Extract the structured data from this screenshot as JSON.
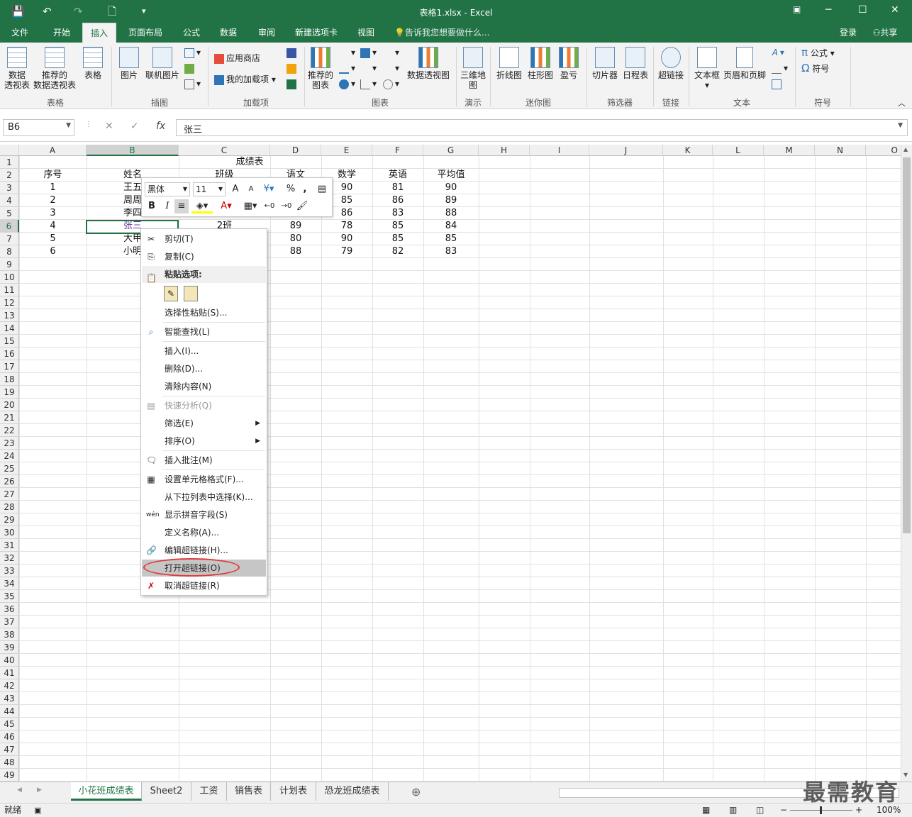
{
  "window": {
    "title": "表格1.xlsx - Excel",
    "restore_icon": "restore-icon",
    "min": "─",
    "max": "☐",
    "close": "✕"
  },
  "quick_access": {
    "save": "💾",
    "undo": "↶",
    "redo": "↷",
    "new": "🗋",
    "more": "▾"
  },
  "tabs": [
    "文件",
    "开始",
    "插入",
    "页面布局",
    "公式",
    "数据",
    "审阅",
    "新建选项卡",
    "视图"
  ],
  "active_tab": "插入",
  "tellme": "告诉我您想要做什么...",
  "login": "登录",
  "share": "共享",
  "ribbon": {
    "pivot": "数据\n透视表",
    "rec_pivot": "推荐的\n数据透视表",
    "table": "表格",
    "group_table": "表格",
    "picture": "图片",
    "online_picture": "联机图片",
    "group_illus": "插图",
    "store": "应用商店",
    "myaddins": "我的加载项",
    "group_addins": "加载项",
    "rec_charts": "推荐的\n图表",
    "pivotchart": "数据透视图",
    "group_charts": "图表",
    "map3d": "三维地\n图",
    "group_tour": "演示",
    "line": "折线图",
    "column": "柱形图",
    "winloss": "盈亏",
    "group_spark": "迷你图",
    "slicer": "切片器",
    "timeline": "日程表",
    "group_filter": "筛选器",
    "hyperlink": "超链接",
    "group_links": "链接",
    "textbox": "文本框",
    "headerfooter": "页眉和页脚",
    "group_text": "文本",
    "equation": "公式",
    "symbol": "符号",
    "group_symbols": "符号"
  },
  "formula_bar": {
    "name_box": "B6",
    "fx": "fx",
    "cancel": "✕",
    "enter": "✓",
    "value": "张三"
  },
  "columns": [
    "A",
    "B",
    "C",
    "D",
    "E",
    "F",
    "G",
    "H",
    "I",
    "J",
    "K",
    "L",
    "M",
    "N",
    "O"
  ],
  "sheet": {
    "title": "成绩表",
    "headers": [
      "序号",
      "姓名",
      "班级",
      "语文",
      "数学",
      "英语",
      "平均值"
    ],
    "rows": [
      [
        "1",
        "王五",
        "",
        "",
        "90",
        "81",
        "90"
      ],
      [
        "2",
        "周周",
        "",
        "",
        "85",
        "86",
        "89"
      ],
      [
        "3",
        "李四",
        "",
        "",
        "86",
        "83",
        "88"
      ],
      [
        "4",
        "张三",
        "2班",
        "89",
        "78",
        "85",
        "84"
      ],
      [
        "5",
        "大甲",
        "",
        "80",
        "90",
        "85",
        "85"
      ],
      [
        "6",
        "小明",
        "",
        "88",
        "79",
        "82",
        "83"
      ]
    ]
  },
  "mini_toolbar": {
    "font": "黑体",
    "size": "11",
    "grow": "A",
    "shrink": "A",
    "percent": "%",
    "comma": ",",
    "bold": "B",
    "italic": "I",
    "fontcolor": "A"
  },
  "context_menu": {
    "cut": "剪切(T)",
    "copy": "复制(C)",
    "paste_header": "粘贴选项:",
    "paste_special": "选择性粘贴(S)...",
    "smart_lookup": "智能查找(L)",
    "insert": "插入(I)...",
    "delete": "删除(D)...",
    "clear": "清除内容(N)",
    "quick_analysis": "快速分析(Q)",
    "filter": "筛选(E)",
    "sort": "排序(O)",
    "insert_comment": "插入批注(M)",
    "format_cells": "设置单元格格式(F)...",
    "pick_list": "从下拉列表中选择(K)...",
    "phonetic": "显示拼音字段(S)",
    "define_name": "定义名称(A)...",
    "edit_link": "编辑超链接(H)...",
    "open_link": "打开超链接(O)",
    "remove_link": "取消超链接(R)"
  },
  "sheet_tabs": [
    "小花班成绩表",
    "Sheet2",
    "工资",
    "销售表",
    "计划表",
    "恐龙班成绩表"
  ],
  "active_sheet": "小花班成绩表",
  "status": {
    "ready": "就绪",
    "zoom": "100%"
  },
  "watermark": "最需教育",
  "colors": {
    "accent": "#217346",
    "highlight_oval": "#e03a3a"
  }
}
